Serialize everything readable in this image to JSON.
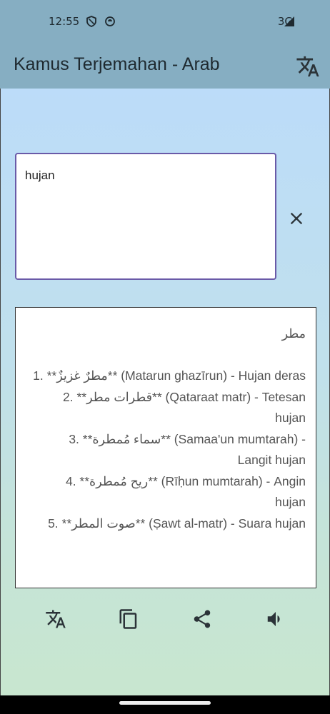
{
  "status_bar": {
    "time": "12:55",
    "network": "3G",
    "icons": [
      "shield-icon",
      "data-saver-icon",
      "signal-icon"
    ]
  },
  "app_bar": {
    "title": "Kamus Terjemahan - Arab",
    "translate_icon": "translate-icon"
  },
  "input": {
    "value": "hujan",
    "clear_icon": "close-icon"
  },
  "output": {
    "text": "مطر\n\n1. **مطرٌ غزيزٌ** (Matarun ghazīrun) - Hujan deras\n2. **قطرات مطر** (Qataraat matr) - Tetesan hujan\n3. **سماء مُمطرة** (Samaa'un mumtarah) - Langit hujan\n4. **ريح مُمطرة** (Rīḥun mumtarah) - Angin hujan\n5. **صوت المطر** (Ṣawt al-matr) - Suara hujan"
  },
  "toolbar": {
    "icons": [
      "translate-icon",
      "copy-icon",
      "share-icon",
      "volume-icon"
    ]
  },
  "colors": {
    "app_bar": "#86aec2",
    "input_border": "#6a5aa8",
    "icon": "#2b3338"
  }
}
